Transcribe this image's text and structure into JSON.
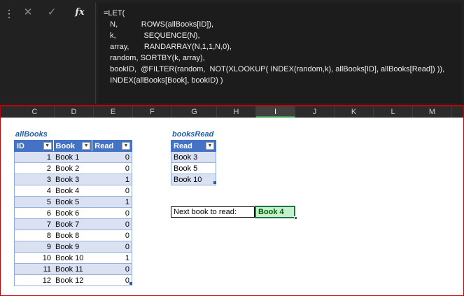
{
  "formula_bar": {
    "icons": [
      "more-options-icon",
      "cancel-icon",
      "enter-icon",
      "insert-function-icon"
    ],
    "lines": [
      "=LET(",
      "   N,           ROWS(allBooks[ID]),",
      "   k,             SEQUENCE(N),",
      "   array,       RANDARRAY(N,1,1,N,0),",
      "   random, SORTBY(k, array),",
      "   bookID,  @FILTER(random,  NOT(XLOOKUP( INDEX(random,k), allBooks[ID], allBooks[Read]) )),",
      "   INDEX(allBooks[Book], bookID) )"
    ]
  },
  "columns": [
    "C",
    "D",
    "E",
    "F",
    "G",
    "H",
    "I",
    "J",
    "K",
    "L",
    "M"
  ],
  "selected_column": "I",
  "allBooks": {
    "title": "allBooks",
    "headers": [
      "ID",
      "Book",
      "Read"
    ],
    "rows": [
      [
        "1",
        "Book 1",
        "0"
      ],
      [
        "2",
        "Book 2",
        "0"
      ],
      [
        "3",
        "Book 3",
        "1"
      ],
      [
        "4",
        "Book 4",
        "0"
      ],
      [
        "5",
        "Book 5",
        "1"
      ],
      [
        "6",
        "Book 6",
        "0"
      ],
      [
        "7",
        "Book 7",
        "0"
      ],
      [
        "8",
        "Book 8",
        "0"
      ],
      [
        "9",
        "Book 9",
        "0"
      ],
      [
        "10",
        "Book 10",
        "1"
      ],
      [
        "11",
        "Book 11",
        "0"
      ],
      [
        "12",
        "Book 12",
        "0"
      ]
    ]
  },
  "booksRead": {
    "title": "booksRead",
    "headers": [
      "Read"
    ],
    "rows": [
      [
        "Book 3"
      ],
      [
        "Book 5"
      ],
      [
        "Book 10"
      ]
    ]
  },
  "next_book": {
    "label": "Next book to read:",
    "value": "Book 4"
  },
  "colors": {
    "table_header": "#4472c4",
    "table_band": "#d9e1f2",
    "result_fill": "#c6efce",
    "result_text": "#006100",
    "frame": "#c00000"
  }
}
